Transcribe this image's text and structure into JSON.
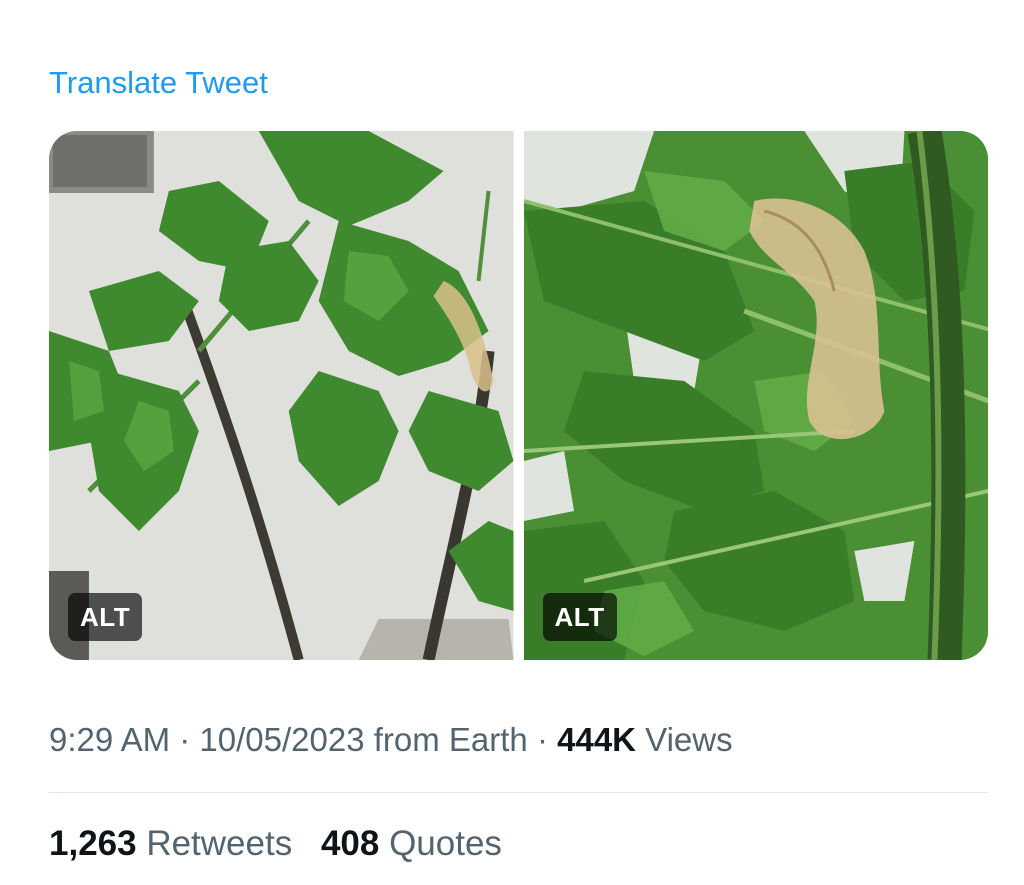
{
  "tweet": {
    "translate_label": "Translate Tweet",
    "media": [
      {
        "alt_badge": "ALT"
      },
      {
        "alt_badge": "ALT"
      }
    ],
    "meta": {
      "time": "9:29 AM",
      "separator": " · ",
      "date": "10/05/2023",
      "source": " from Earth",
      "views_count": "444K",
      "views_label": " Views"
    },
    "stats": {
      "retweets_count": "1,263",
      "retweets_label": " Retweets",
      "quotes_count": "408",
      "quotes_label": " Quotes"
    }
  },
  "colors": {
    "link": "#1d9bf0",
    "secondary_text": "#536471",
    "primary_text": "#0f1419",
    "leaf_green": "#3f8a2e"
  }
}
